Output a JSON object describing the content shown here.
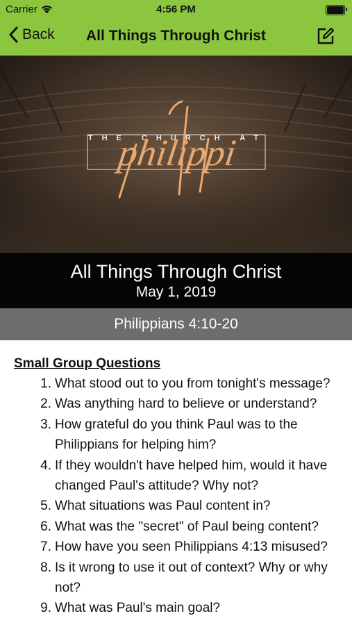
{
  "status": {
    "carrier": "Carrier",
    "time": "4:56 PM"
  },
  "nav": {
    "back_label": "Back",
    "title": "All Things Through Christ",
    "bar_color": "#8cc63f"
  },
  "banner": {
    "series_overlay": "THE CHURCH AT",
    "series_script": "philippi"
  },
  "sermon": {
    "title": "All Things Through Christ",
    "date": "May 1, 2019",
    "scripture": "Philippians 4:10-20"
  },
  "questions": {
    "heading": "Small Group Questions",
    "items": [
      {
        "num": "1.",
        "text": "What stood out to you from tonight's message?"
      },
      {
        "num": "2.",
        "text": "Was anything hard to believe or understand?"
      },
      {
        "num": "3.",
        "text": "How grateful do you think Paul was to the Philippians for helping him?"
      },
      {
        "num": "4.",
        "text": "If they wouldn't have helped him, would it have changed Paul's attitude? Why not?"
      },
      {
        "num": "5.",
        "text": "What situations was Paul content in?"
      },
      {
        "num": "6.",
        "text": "What was the \"secret\" of Paul being content?"
      },
      {
        "num": "7.",
        "text": "How have you seen Philippians 4:13 misused?"
      },
      {
        "num": "8.",
        "text": "Is it wrong to use it out of context? Why or why not?"
      },
      {
        "num": "9.",
        "text": "What was Paul's main goal?"
      }
    ]
  }
}
